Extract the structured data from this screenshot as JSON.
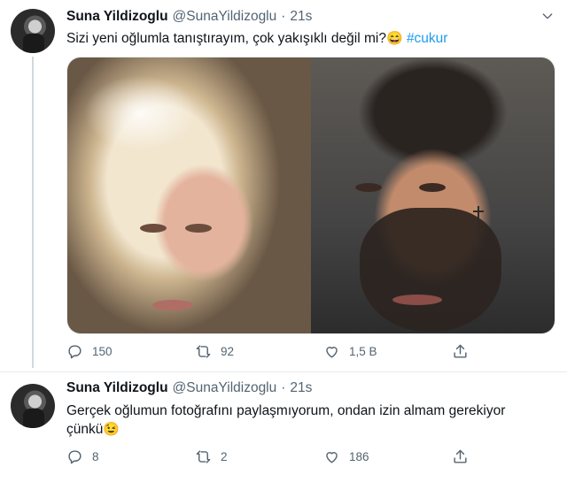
{
  "tweets": [
    {
      "name": "Suna Yildizoglu",
      "handle": "@SunaYildizoglu",
      "dot": "·",
      "time": "21s",
      "text_main": "Sizi yeni oğlumla tanıştırayım, çok yakışıklı değil mi?",
      "emoji": "😄",
      "hashtag": "#cukur",
      "stats": {
        "replies": "150",
        "retweets": "92",
        "likes": "1,5 B"
      }
    },
    {
      "name": "Suna Yildizoglu",
      "handle": "@SunaYildizoglu",
      "dot": "·",
      "time": "21s",
      "text_main": "Gerçek oğlumun fotoğrafını paylaşmıyorum, ondan izin almam gerekiyor çünkü",
      "emoji": "😉",
      "stats": {
        "replies": "8",
        "retweets": "2",
        "likes": "186"
      }
    }
  ],
  "icons": [
    "chevron-down-icon",
    "reply-icon",
    "retweet-icon",
    "like-icon",
    "share-icon"
  ],
  "colors": {
    "hashtag": "#1d9bf0",
    "secondary_text": "#536471",
    "thread_line": "#cfd9de"
  }
}
